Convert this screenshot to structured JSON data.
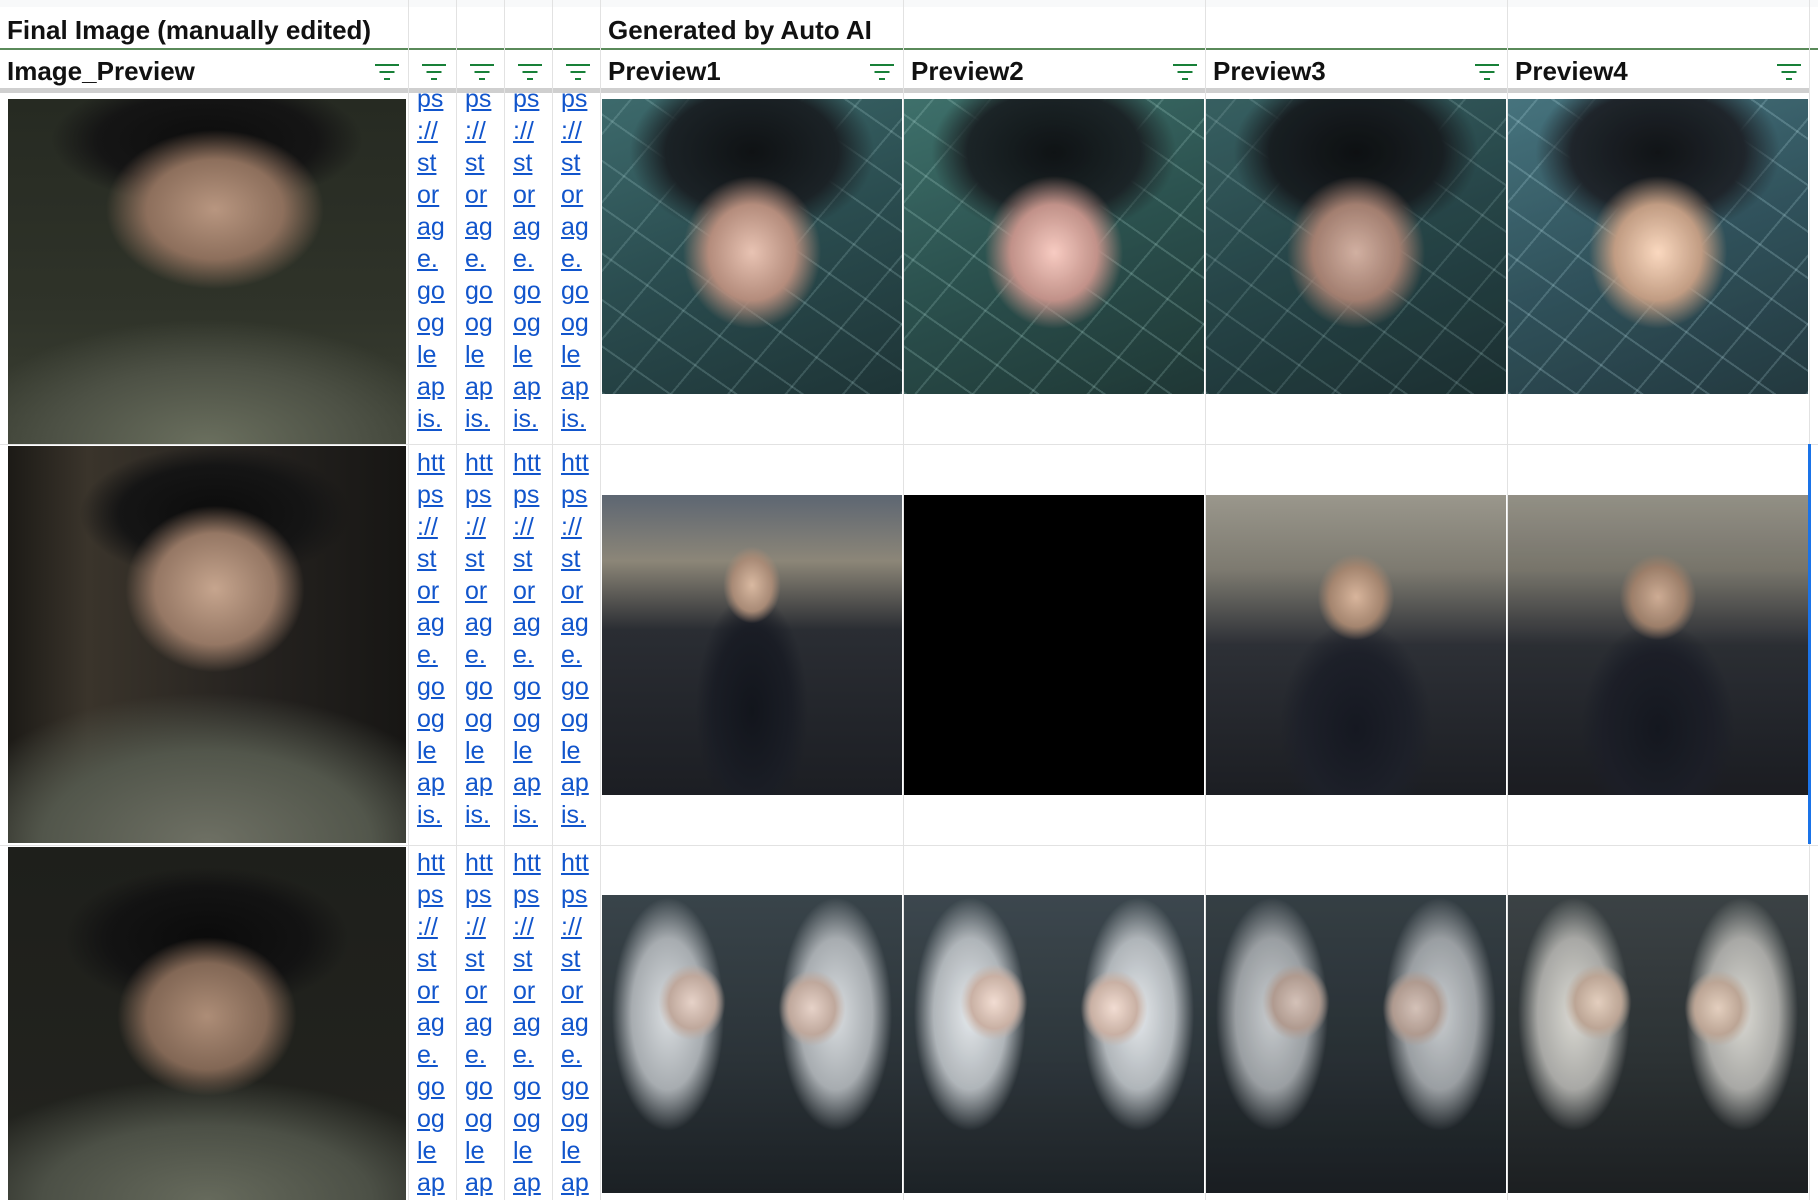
{
  "group_headers": {
    "final": "Final Image (manually edited)",
    "generated": "Generated by Auto AI"
  },
  "columns": {
    "image_preview": "Image_Preview",
    "preview1": "Preview1",
    "preview2": "Preview2",
    "preview3": "Preview3",
    "preview4": "Preview4"
  },
  "link_text": {
    "row1": "ps\n://\nst\nor\nag\ne.\ngo\nog\nle\nap\nis.",
    "row2": "htt\nps\n://\nst\nor\nag\ne.\ngo\nog\nle\nap\nis.",
    "row3": "htt\nps\n://\nst\nor\nag\ne.\ngo\nog\nle\nap\nis."
  },
  "colors": {
    "link": "#1155cc",
    "filter_icon": "#188038",
    "selection": "#1a73e8",
    "group_border": "#5a8a5a"
  }
}
